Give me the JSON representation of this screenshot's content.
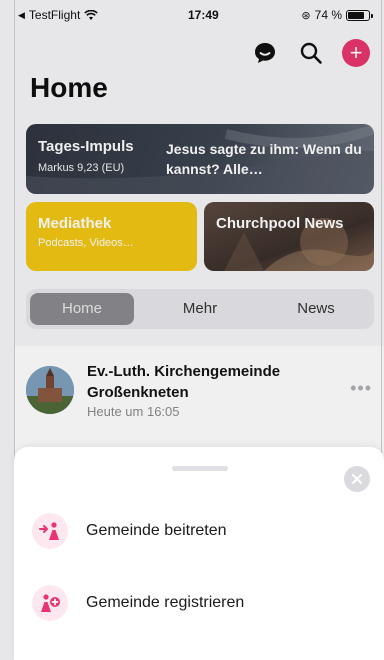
{
  "status_bar": {
    "back_app": "TestFlight",
    "time": "17:49",
    "battery_percent": "74 %",
    "battery_level": 0.74
  },
  "header": {
    "title": "Home",
    "icons": [
      "chat-icon",
      "search-icon",
      "plus-icon"
    ]
  },
  "cards": {
    "tages": {
      "title": "Tages-Impuls",
      "subtitle": "Markus 9,23 (EU)",
      "quote": "Jesus sagte zu ihm: Wenn du kannst? Alle…"
    },
    "mediathek": {
      "title": "Mediathek",
      "subtitle": "Podcasts, Videos…"
    },
    "news": {
      "title": "Churchpool News"
    }
  },
  "tabs": [
    {
      "label": "Home",
      "active": true
    },
    {
      "label": "Mehr",
      "active": false
    },
    {
      "label": "News",
      "active": false
    }
  ],
  "feed": {
    "post": {
      "title": "Ev.-Luth. Kirchengemeinde Großenkneten",
      "time": "Heute um 16:05"
    }
  },
  "sheet": {
    "actions": [
      {
        "label": "Gemeinde beitreten",
        "icon": "join-community-icon"
      },
      {
        "label": "Gemeinde registrieren",
        "icon": "register-community-icon"
      }
    ]
  },
  "colors": {
    "accent": "#e8356d",
    "mediathek": "#f2c614"
  }
}
